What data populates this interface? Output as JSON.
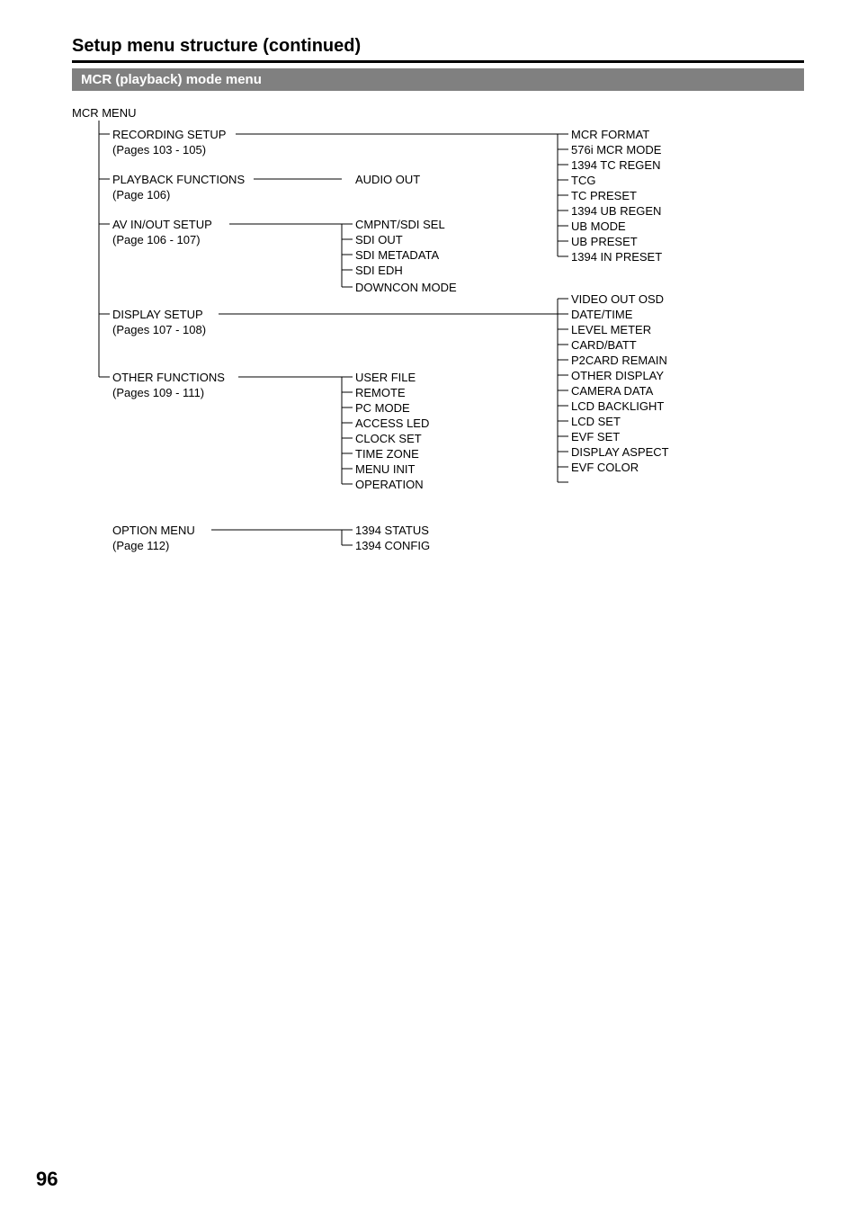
{
  "header": {
    "section_title": "Setup menu structure (continued)",
    "mode_bar": "MCR (playback) mode menu"
  },
  "tree": {
    "root": "MCR MENU",
    "col1": {
      "recording_setup": "RECORDING SETUP",
      "recording_setup_pages": "(Pages 103 - 105)",
      "playback_functions": "PLAYBACK FUNCTIONS",
      "playback_functions_pages": "(Page 106)",
      "av_inout_setup": "AV IN/OUT SETUP",
      "av_inout_setup_pages": "(Page 106 - 107)",
      "display_setup": "DISPLAY SETUP",
      "display_setup_pages": "(Pages 107 - 108)",
      "other_functions": "OTHER FUNCTIONS",
      "other_functions_pages": "(Pages 109 - 111)",
      "option_menu": "OPTION MENU",
      "option_menu_pages": "(Page 112)"
    },
    "col2": {
      "audio_out": "AUDIO OUT",
      "cmpnt_sdi_sel": "CMPNT/SDI SEL",
      "sdi_out": "SDI OUT",
      "sdi_metadata": "SDI METADATA",
      "sdi_edh": "SDI EDH",
      "downcon_mode": "DOWNCON MODE",
      "user_file": "USER FILE",
      "remote": "REMOTE",
      "pc_mode": "PC MODE",
      "access_led": "ACCESS LED",
      "clock_set": "CLOCK SET",
      "time_zone": "TIME ZONE",
      "menu_init": "MENU INIT",
      "operation": "OPERATION",
      "status_1394": "1394 STATUS",
      "config_1394": "1394 CONFIG"
    },
    "col3": {
      "mcr_format": "MCR FORMAT",
      "mcr_mode_576i": "576i MCR MODE",
      "tc_regen_1394": "1394 TC REGEN",
      "tcg": "TCG",
      "tc_preset": "TC PRESET",
      "ub_regen_1394": "1394 UB REGEN",
      "ub_mode": "UB MODE",
      "ub_preset": "UB PRESET",
      "in_preset_1394": "1394 IN PRESET",
      "video_out_osd": "VIDEO OUT OSD",
      "date_time": "DATE/TIME",
      "level_meter": "LEVEL METER",
      "card_batt": "CARD/BATT",
      "p2card_remain": "P2CARD REMAIN",
      "other_display": "OTHER DISPLAY",
      "camera_data": "CAMERA DATA",
      "lcd_backlight": "LCD BACKLIGHT",
      "lcd_set": "LCD SET",
      "evf_set": "EVF SET",
      "display_aspect": "DISPLAY ASPECT",
      "evf_color": "EVF COLOR"
    }
  },
  "footer": {
    "page_number": "96"
  }
}
